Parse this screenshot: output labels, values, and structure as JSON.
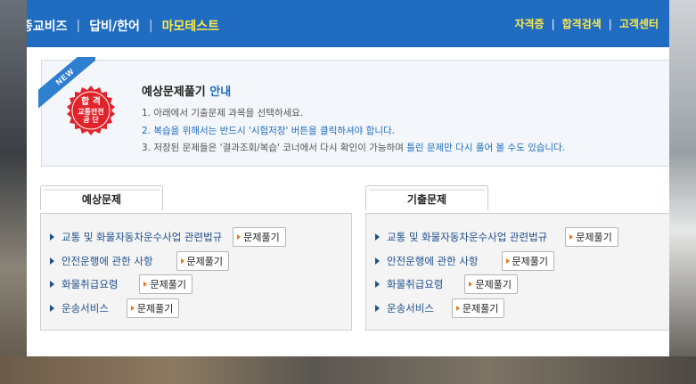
{
  "nav": {
    "items": [
      "종교비즈",
      "답비/한어",
      "마모테스트"
    ],
    "active_index": 2,
    "right_items": [
      "자격증",
      "합격검색",
      "고객센터"
    ]
  },
  "notice": {
    "ribbon": "NEW",
    "seal": {
      "line1": "합 격",
      "line2": "교통안전",
      "line3": "공 단"
    },
    "title_main": "예상문제풀기",
    "title_accent": "안내",
    "line1": "1. 아래에서 기출문제 과목을 선택하세요.",
    "line2": "2. 복습을 위해서는 반드시 '시험저장' 버튼을 클릭하셔야 합니다.",
    "line3_a": "3. 저장된 문제들은 '결과조회/복습' 코너에서 다시 확인이 가능하며 ",
    "line3_b": "틀린 문제만 다시 풀어 볼 수도 있습니다."
  },
  "colors": {
    "nav_bg": "#1f6cc0",
    "nav_active": "#ffe94a",
    "seal_red": "#e0242c",
    "link": "#1f4f8e"
  },
  "panels": [
    {
      "tab": "예상문제",
      "items": [
        {
          "label": "교통 및 화물자동차운수사업 관련법규",
          "button": "문제풀기"
        },
        {
          "label": "안전운행에 관한 사항",
          "button": "문제풀기"
        },
        {
          "label": "화물취급요령",
          "button": "문제풀기"
        },
        {
          "label": "운송서비스",
          "button": "문제풀기"
        }
      ]
    },
    {
      "tab": "기출문제",
      "items": [
        {
          "label": "교통 및 화물자동차운수사업 관련법규",
          "button": "문제풀기"
        },
        {
          "label": "안전운행에 관한 사항",
          "button": "문제풀기"
        },
        {
          "label": "화물취급요령",
          "button": "문제풀기"
        },
        {
          "label": "운송서비스",
          "button": "문제풀기"
        }
      ]
    }
  ]
}
